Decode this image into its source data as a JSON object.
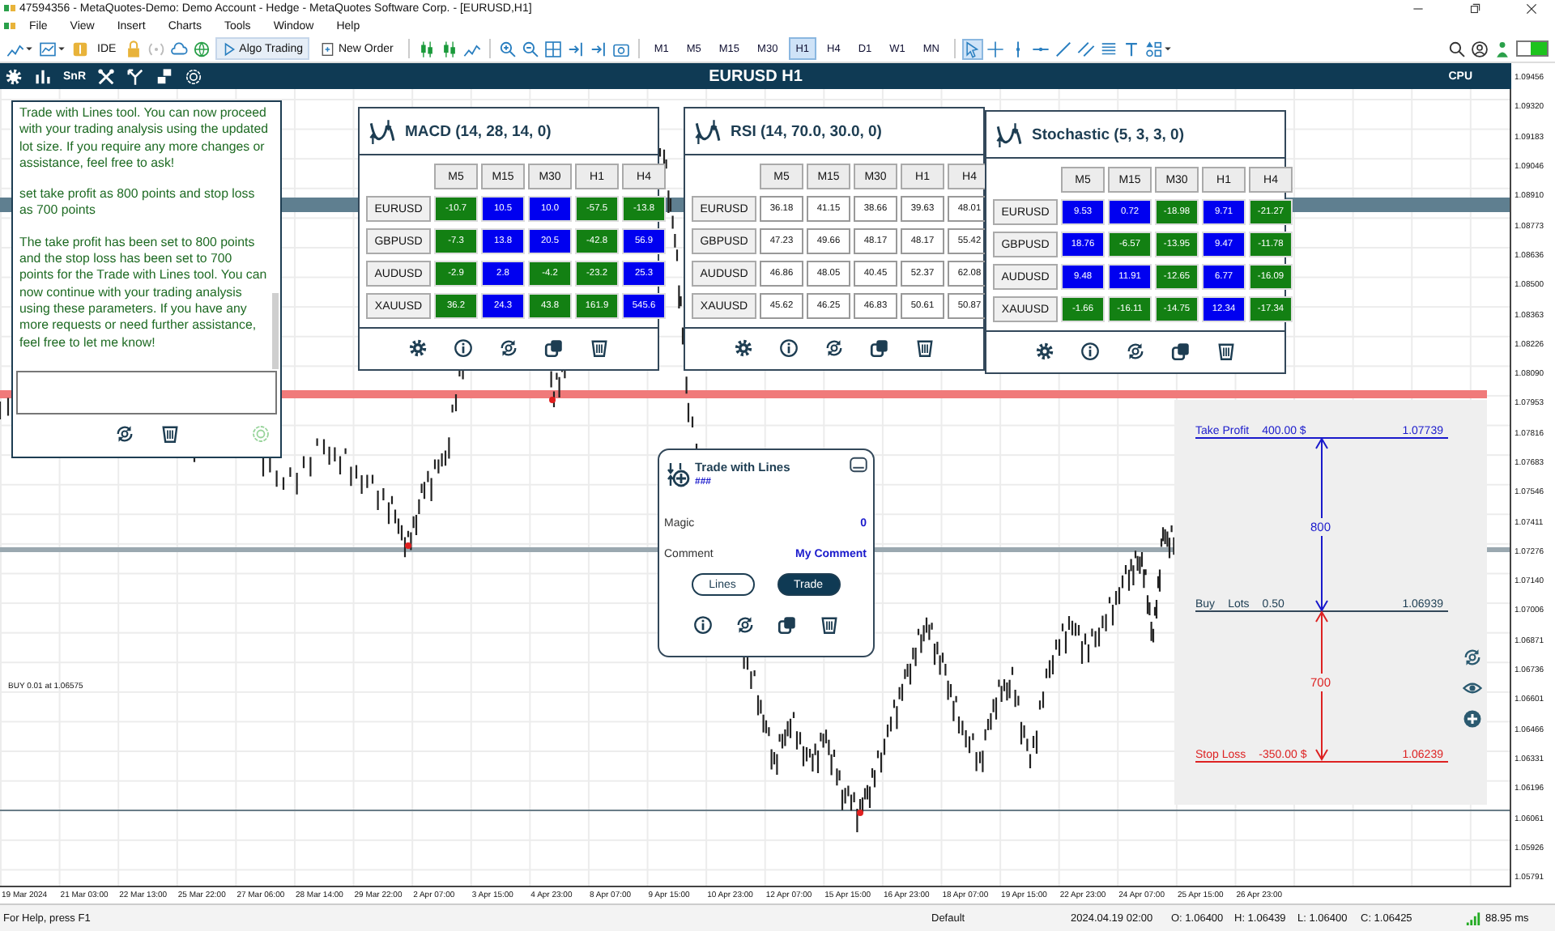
{
  "window": {
    "title": "47594356 - MetaQuotes-Demo: Demo Account - Hedge - MetaQuotes Software Corp. - [EURUSD,H1]"
  },
  "menu": [
    "File",
    "View",
    "Insert",
    "Charts",
    "Tools",
    "Window",
    "Help"
  ],
  "toolbar": {
    "toggle_on": true,
    "ide": "IDE",
    "algo_trading": "Algo Trading",
    "new_order": "New Order",
    "timeframes": [
      {
        "label": "M1",
        "selected": false
      },
      {
        "label": "M5",
        "selected": false
      },
      {
        "label": "M15",
        "selected": false
      },
      {
        "label": "M30",
        "selected": false
      },
      {
        "label": "H1",
        "selected": true
      },
      {
        "label": "H4",
        "selected": false
      },
      {
        "label": "D1",
        "selected": false
      },
      {
        "label": "W1",
        "selected": false
      },
      {
        "label": "MN",
        "selected": false
      }
    ]
  },
  "panel_bar": {
    "snr": "SnR",
    "title": "EURUSD H1",
    "cpu": "CPU"
  },
  "chat": {
    "messages": [
      "Trade with Lines tool. You can now proceed with your trading analysis using the updated lot size. If you require any more changes or assistance, feel free to ask!",
      "set take profit as 800 points and stop loss as 700 points",
      "The take profit has been set to 800 points and the stop loss has been set to 700 points for the Trade with Lines tool. You can now continue with your trading analysis using these parameters. If you have any more requests or need further assistance, feel free to let me know!"
    ]
  },
  "indicators": [
    {
      "title": "MACD (14, 28, 14, 0)",
      "columns": [
        "M5",
        "M15",
        "M30",
        "H1",
        "H4"
      ],
      "rows": [
        {
          "symbol": "EURUSD",
          "cells": [
            {
              "value": "-10.7",
              "color": "#138013"
            },
            {
              "value": "10.5",
              "color": "#0000f0"
            },
            {
              "value": "10.0",
              "color": "#0000f0"
            },
            {
              "value": "-57.5",
              "color": "#138013"
            },
            {
              "value": "-13.8",
              "color": "#138013"
            }
          ]
        },
        {
          "symbol": "GBPUSD",
          "cells": [
            {
              "value": "-7.3",
              "color": "#138013"
            },
            {
              "value": "13.8",
              "color": "#0000f0"
            },
            {
              "value": "20.5",
              "color": "#0000f0"
            },
            {
              "value": "-42.8",
              "color": "#138013"
            },
            {
              "value": "56.9",
              "color": "#0000f0"
            }
          ]
        },
        {
          "symbol": "AUDUSD",
          "cells": [
            {
              "value": "-2.9",
              "color": "#138013"
            },
            {
              "value": "2.8",
              "color": "#0000f0"
            },
            {
              "value": "-4.2",
              "color": "#138013"
            },
            {
              "value": "-23.2",
              "color": "#138013"
            },
            {
              "value": "25.3",
              "color": "#0000f0"
            }
          ]
        },
        {
          "symbol": "XAUUSD",
          "cells": [
            {
              "value": "36.2",
              "color": "#138013"
            },
            {
              "value": "24.3",
              "color": "#0000f0"
            },
            {
              "value": "43.8",
              "color": "#138013"
            },
            {
              "value": "161.9",
              "color": "#138013"
            },
            {
              "value": "545.6",
              "color": "#0000f0"
            }
          ]
        }
      ]
    },
    {
      "title": "RSI (14, 70.0, 30.0, 0)",
      "columns": [
        "M5",
        "M15",
        "M30",
        "H1",
        "H4"
      ],
      "rows": [
        {
          "symbol": "EURUSD",
          "cells": [
            {
              "value": "36.18"
            },
            {
              "value": "41.15"
            },
            {
              "value": "38.66"
            },
            {
              "value": "39.63"
            },
            {
              "value": "48.01"
            }
          ]
        },
        {
          "symbol": "GBPUSD",
          "cells": [
            {
              "value": "47.23"
            },
            {
              "value": "49.66"
            },
            {
              "value": "48.17"
            },
            {
              "value": "48.17"
            },
            {
              "value": "55.42"
            }
          ]
        },
        {
          "symbol": "AUDUSD",
          "cells": [
            {
              "value": "46.86"
            },
            {
              "value": "48.05"
            },
            {
              "value": "40.45"
            },
            {
              "value": "52.37"
            },
            {
              "value": "62.08"
            }
          ]
        },
        {
          "symbol": "XAUUSD",
          "cells": [
            {
              "value": "45.62"
            },
            {
              "value": "46.25"
            },
            {
              "value": "46.83"
            },
            {
              "value": "50.61"
            },
            {
              "value": "50.87"
            }
          ]
        }
      ]
    },
    {
      "title": "Stochastic (5, 3, 3, 0)",
      "columns": [
        "M5",
        "M15",
        "M30",
        "H1",
        "H4"
      ],
      "rows": [
        {
          "symbol": "EURUSD",
          "cells": [
            {
              "value": "9.53",
              "color": "#0000f0"
            },
            {
              "value": "0.72",
              "color": "#0000f0"
            },
            {
              "value": "-18.98",
              "color": "#138013"
            },
            {
              "value": "9.71",
              "color": "#0000f0"
            },
            {
              "value": "-21.27",
              "color": "#138013"
            }
          ]
        },
        {
          "symbol": "GBPUSD",
          "cells": [
            {
              "value": "18.76",
              "color": "#0000f0"
            },
            {
              "value": "-6.57",
              "color": "#138013"
            },
            {
              "value": "-13.95",
              "color": "#138013"
            },
            {
              "value": "9.47",
              "color": "#0000f0"
            },
            {
              "value": "-11.78",
              "color": "#138013"
            }
          ]
        },
        {
          "symbol": "AUDUSD",
          "cells": [
            {
              "value": "9.48",
              "color": "#0000f0"
            },
            {
              "value": "11.91",
              "color": "#0000f0"
            },
            {
              "value": "-12.65",
              "color": "#138013"
            },
            {
              "value": "6.77",
              "color": "#0000f0"
            },
            {
              "value": "-16.09",
              "color": "#138013"
            }
          ]
        },
        {
          "symbol": "XAUUSD",
          "cells": [
            {
              "value": "-1.66",
              "color": "#138013"
            },
            {
              "value": "-16.11",
              "color": "#138013"
            },
            {
              "value": "-14.75",
              "color": "#138013"
            },
            {
              "value": "12.34",
              "color": "#0000f0"
            },
            {
              "value": "-17.34",
              "color": "#138013"
            }
          ]
        }
      ]
    }
  ],
  "trade_panel": {
    "title": "Trade with Lines",
    "subtitle": "###",
    "fields": [
      {
        "label": "Magic",
        "value": "0"
      },
      {
        "label": "Comment",
        "value": "My Comment"
      }
    ],
    "buttons": [
      {
        "label": "Lines",
        "selected": false
      },
      {
        "label": "Trade",
        "selected": true
      }
    ]
  },
  "trade_lines": {
    "take_profit": {
      "label": "Take Profit",
      "amount": "400.00 $",
      "price": "1.07739"
    },
    "entry": {
      "side": "Buy",
      "lots_label": "Lots",
      "lots": "0.50",
      "price": "1.06939"
    },
    "stop_loss": {
      "label": "Stop Loss",
      "amount": "-350.00 $",
      "price": "1.06239"
    },
    "tp_distance": "800",
    "sl_distance": "700"
  },
  "chart": {
    "order_label": "BUY 0.01 at 1.06575",
    "price_axis": [
      "1.09456",
      "1.09320",
      "1.09183",
      "1.09046",
      "1.08910",
      "1.08773",
      "1.08636",
      "1.08500",
      "1.08363",
      "1.08226",
      "1.08090",
      "1.07953",
      "1.07816",
      "1.07683",
      "1.07546",
      "1.07411",
      "1.07276",
      "1.07140",
      "1.07006",
      "1.06871",
      "1.06736",
      "1.06601",
      "1.06466",
      "1.06331",
      "1.06196",
      "1.06061",
      "1.05926",
      "1.05791"
    ],
    "time_axis": [
      "19 Mar 2024",
      "21 Mar 03:00",
      "22 Mar 13:00",
      "25 Mar 22:00",
      "27 Mar 06:00",
      "28 Mar 14:00",
      "29 Mar 22:00",
      "2 Apr 07:00",
      "3 Apr 15:00",
      "4 Apr 23:00",
      "8 Apr 07:00",
      "9 Apr 15:00",
      "10 Apr 23:00",
      "12 Apr 07:00",
      "15 Apr 15:00",
      "16 Apr 23:00",
      "18 Apr 07:00",
      "19 Apr 15:00",
      "22 Apr 23:00",
      "24 Apr 07:00",
      "25 Apr 15:00",
      "26 Apr 23:00"
    ]
  },
  "status_bar": {
    "help": "For Help, press F1",
    "profile": "Default",
    "datetime": "2024.04.19 02:00",
    "open": "O: 1.06400",
    "high": "H: 1.06439",
    "low": "L: 1.06400",
    "close": "C: 1.06425",
    "ping": "88.95 ms"
  }
}
